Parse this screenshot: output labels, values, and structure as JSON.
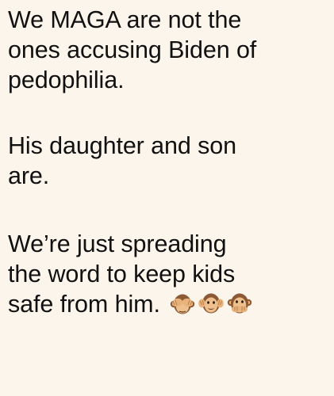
{
  "post": {
    "paragraphs": [
      {
        "lines": [
          "We MAGA are not the",
          "ones accusing Biden of",
          "pedophilia."
        ]
      },
      {
        "lines": [
          "His daughter and son",
          "are."
        ]
      },
      {
        "lines": [
          "We’re just spreading",
          "the word to keep kids",
          "safe from him."
        ]
      }
    ],
    "emojis": [
      "see-no-evil-monkey-icon",
      "hear-no-evil-monkey-icon",
      "speak-no-evil-monkey-icon"
    ]
  },
  "colors": {
    "background": "#fbf5ec",
    "text": "#111111"
  }
}
